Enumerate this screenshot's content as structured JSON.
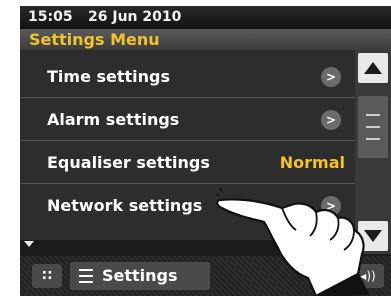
{
  "status": {
    "time": "15:05",
    "date": "26 Jun 2010"
  },
  "header": {
    "title": "Settings Menu"
  },
  "menu": {
    "items": [
      {
        "label": "Time settings",
        "trailing": ">"
      },
      {
        "label": "Alarm settings",
        "trailing": ">"
      },
      {
        "label": "Equaliser settings",
        "value": "Normal"
      },
      {
        "label": "Network settings",
        "trailing": ">"
      }
    ]
  },
  "bottom": {
    "settings_label": "Settings",
    "back_glyph": "<",
    "volume_glyph": "◂))"
  },
  "icons": {
    "scroll_up": "up-triangle-icon",
    "scroll_down": "down-triangle-icon",
    "grid": "grid-icon",
    "menu": "hamburger-icon",
    "pointer": "pointing-hand-icon"
  },
  "colors": {
    "accent": "#f3c22e",
    "background": "#1b1b1b",
    "button": "#e9e9e9"
  }
}
